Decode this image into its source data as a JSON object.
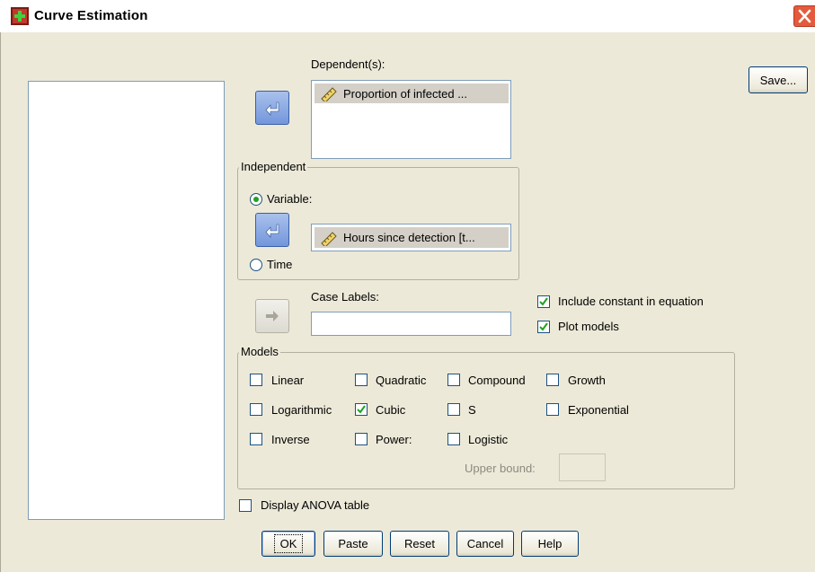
{
  "window": {
    "title": "Curve Estimation",
    "close_icon": "close-icon"
  },
  "dependent": {
    "label": "Dependent(s):",
    "items": [
      "Proportion of infected ..."
    ],
    "item_icon": "scale-ruler-icon"
  },
  "independent": {
    "legend": "Independent",
    "variable_label": "Variable:",
    "time_label": "Time",
    "selected": "Variable",
    "variable_value": "Hours since detection [t..."
  },
  "case_labels": {
    "label": "Case Labels:",
    "value": ""
  },
  "options": {
    "include_constant": {
      "label": "Include constant in equation",
      "checked": true
    },
    "plot_models": {
      "label": "Plot models",
      "checked": true
    },
    "display_anova": {
      "label": "Display ANOVA table",
      "checked": false
    }
  },
  "models": {
    "legend": "Models",
    "items": [
      {
        "label": "Linear",
        "checked": false
      },
      {
        "label": "Quadratic",
        "checked": false
      },
      {
        "label": "Compound",
        "checked": false
      },
      {
        "label": "Growth",
        "checked": false
      },
      {
        "label": "Logarithmic",
        "checked": false
      },
      {
        "label": "Cubic",
        "checked": true
      },
      {
        "label": "S",
        "checked": false
      },
      {
        "label": "Exponential",
        "checked": false
      },
      {
        "label": "Inverse",
        "checked": false
      },
      {
        "label": "Power:",
        "checked": false
      },
      {
        "label": "Logistic",
        "checked": false
      }
    ],
    "upper_bound_label": "Upper bound:",
    "upper_bound_value": ""
  },
  "buttons": {
    "save": "Save...",
    "ok": "OK",
    "paste": "Paste",
    "reset": "Reset",
    "cancel": "Cancel",
    "help": "Help"
  },
  "colors": {
    "dialog_bg": "#ece9d8",
    "arrow_button": "#7396db",
    "check_mark": "#21a121",
    "close_button": "#e35a3c"
  }
}
